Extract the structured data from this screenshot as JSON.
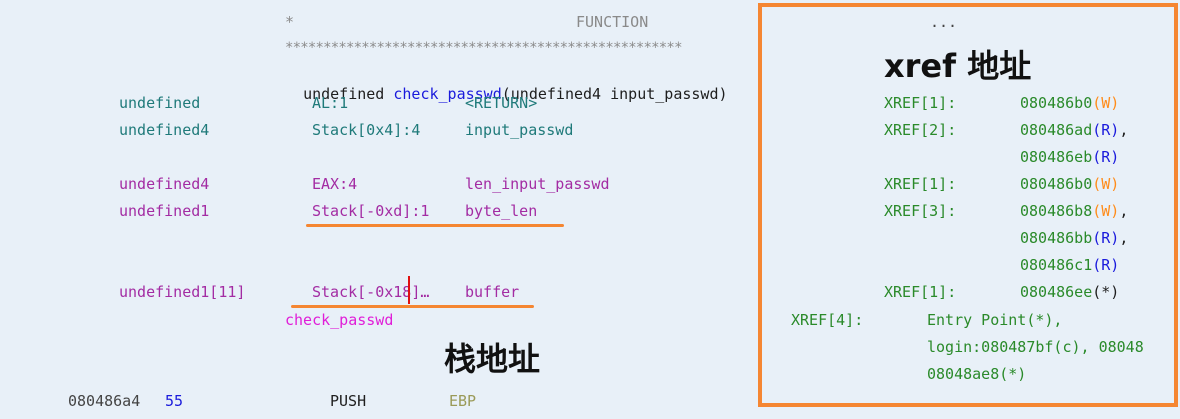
{
  "header": {
    "star_left": "*",
    "function_label": "FUNCTION",
    "ellipsis": "...",
    "stars": "****************************************************"
  },
  "signature": {
    "return_type": "undefined",
    "func_name": "check_passwd",
    "params_open": "(",
    "param_type": "undefined4",
    "param_name": "input_passwd",
    "params_close": ")"
  },
  "vars": [
    {
      "type": "undefined",
      "storage": "AL:1",
      "name": "<RETURN>",
      "xref_label": "XREF[1]:",
      "xrefs": [
        {
          "addr": "080486b0",
          "acc": "(W)"
        }
      ]
    },
    {
      "type": "undefined4",
      "storage": "Stack[0x4]:4",
      "name": "input_passwd",
      "xref_label": "XREF[2]:",
      "xrefs": [
        {
          "addr": "080486ad",
          "acc": "(R)",
          "sep": ","
        },
        {
          "addr": "080486eb",
          "acc": "(R)"
        }
      ]
    },
    {
      "type": "undefined4",
      "storage": "EAX:4",
      "name": "len_input_passwd",
      "xref_label": "XREF[1]:",
      "xrefs": [
        {
          "addr": "080486b0",
          "acc": "(W)"
        }
      ]
    },
    {
      "type": "undefined1",
      "storage": "Stack[-0xd]:1",
      "name": "byte_len",
      "xref_label": "XREF[3]:",
      "xrefs": [
        {
          "addr": "080486b8",
          "acc": "(W)",
          "sep": ","
        },
        {
          "addr": "080486bb",
          "acc": "(R)",
          "sep": ","
        },
        {
          "addr": "080486c1",
          "acc": "(R)"
        }
      ]
    },
    {
      "type": "undefined1[11]",
      "storage": "Stack[-0x18]…",
      "name": "buffer",
      "xref_label": "XREF[1]:",
      "xrefs": [
        {
          "addr": "080486ee",
          "acc": "(*)"
        }
      ]
    }
  ],
  "label": {
    "name": "check_passwd",
    "xref_label": "XREF[4]:",
    "lines": [
      "Entry Point(*),",
      "login:080487bf(c), 08048",
      "08048ae8(*)"
    ]
  },
  "instruction": {
    "address": "080486a4",
    "bytes": "55",
    "mnemonic": "PUSH",
    "operand": "EBP"
  },
  "annotations": {
    "xref_addr": "xref 地址",
    "stack_addr": "栈地址"
  },
  "colors": {
    "highlight_box": "#f58632",
    "cursor": "#e01010",
    "background": "#e8f0f8"
  }
}
